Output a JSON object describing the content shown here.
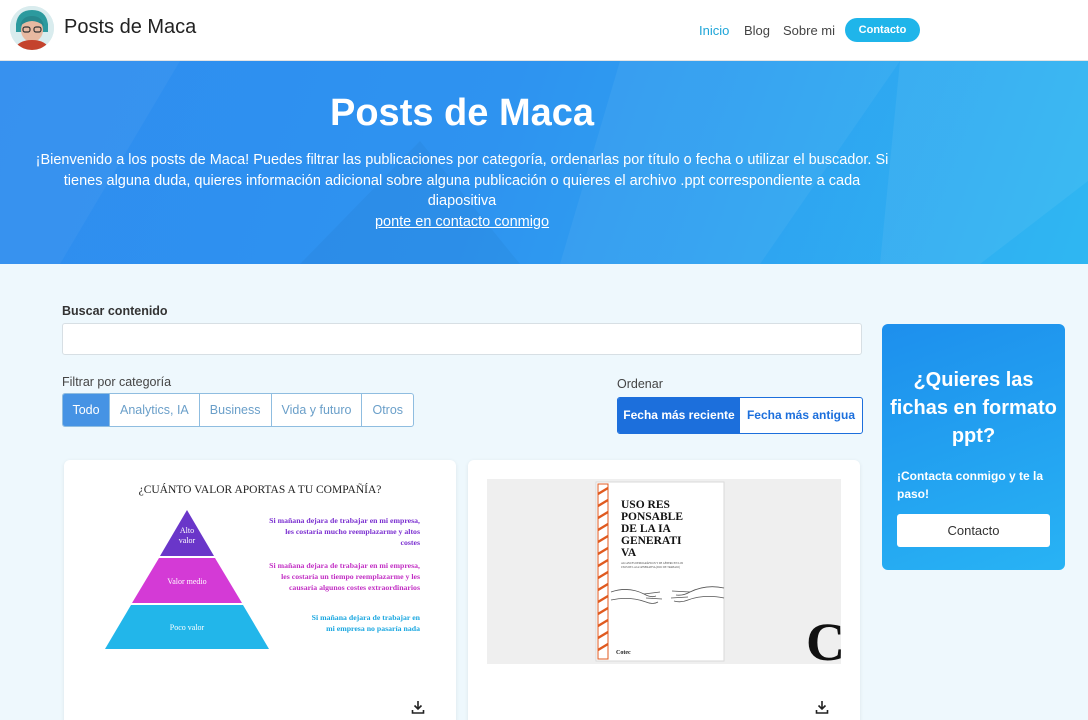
{
  "header": {
    "brand": "Posts de Maca",
    "nav": {
      "home": "Inicio",
      "blog": "Blog",
      "about": "Sobre mi",
      "contact": "Contacto"
    }
  },
  "hero": {
    "title": "Posts de Maca",
    "text": "¡Bienvenido a los posts de Maca! Puedes filtrar las publicaciones por categoría, ordenarlas por título o fecha o utilizar el buscador. Si tienes alguna duda, quieres información adicional sobre alguna publicación o quieres el archivo .ppt correspondiente a cada diapositiva",
    "link": "ponte en contacto conmigo"
  },
  "search": {
    "label": "Buscar contenido",
    "value": "",
    "placeholder": ""
  },
  "filters": {
    "label": "Filtrar por categoría",
    "items": [
      "Todo",
      "Analytics, IA",
      "Business",
      "Vida y futuro",
      "Otros"
    ],
    "selected": "Todo"
  },
  "sort": {
    "label": "Ordenar",
    "options": [
      "Fecha más reciente",
      "Fecha más antigua"
    ],
    "selected": "Fecha más reciente"
  },
  "cards": [
    {
      "pyramid": {
        "title": "¿CUÁNTO VALOR APORTAS A TU COMPAÑÍA?",
        "levels": [
          {
            "label": "Alto valor",
            "lines": [
              "Alto",
              "valor"
            ],
            "color": "#6a36c9",
            "text_color": "#7a2fd0",
            "note": [
              "Si mañana dejara de trabajar en mi empresa,",
              "les costaría mucho reemplazarme y altos",
              "costes"
            ]
          },
          {
            "label": "Valor medio",
            "color": "#d43ad6",
            "text_color": "#c22fc4",
            "note": [
              "Si mañana dejara de trabajar en mi empresa,",
              "les costaría un tiempo reemplazarme y les",
              "causaría algunos costes extraordinarios"
            ]
          },
          {
            "label": "Poco valor",
            "color": "#22b6ea",
            "text_color": "#1aa7e0",
            "note": [
              "Si mañana dejara de trabajar en",
              "mi empresa no pasaría nada"
            ]
          }
        ]
      },
      "icon": "download-icon"
    },
    {
      "book": {
        "title_lines": [
          "USO RES",
          "PONSABLE",
          "DE LA IA",
          "GENERATI",
          "VA"
        ],
        "subtitle": [
          "ALCANCES DEMOGRÁFICOS Y DE GÉNERO EN LOS",
          "USOS DE LA IA GENERATIVA (DOC DE TRABAJO)"
        ],
        "publisher": "Cotec",
        "side_letter": "C"
      },
      "icon": "download-icon"
    }
  ],
  "promo": {
    "title": "¿Quieres las fichas en formato ppt?",
    "text": "¡Contacta conmigo y te la paso!",
    "button": "Contacto"
  },
  "colors": {
    "accent": "#1fb5ea",
    "primary": "#1c6fdc",
    "hero_start": "#2f8def",
    "hero_end": "#2fb7f2"
  }
}
